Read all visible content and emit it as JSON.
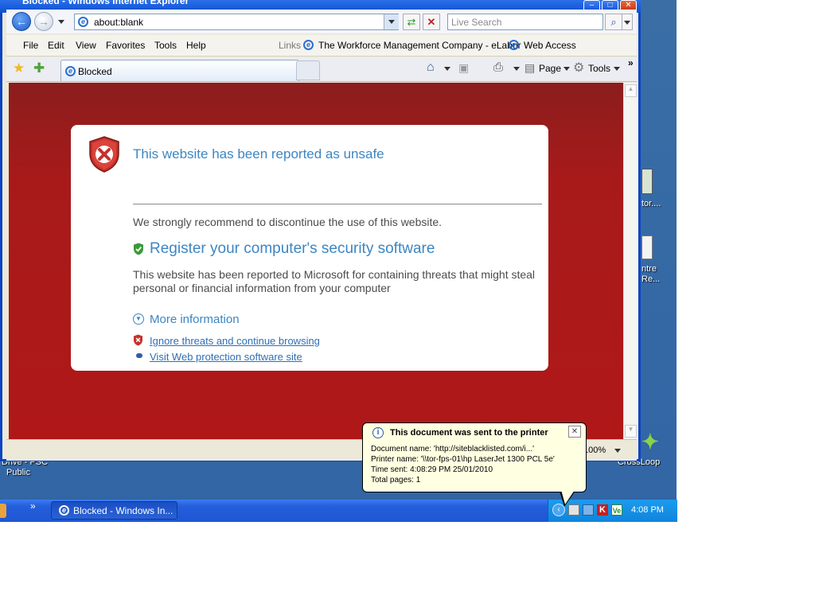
{
  "window": {
    "title": "Blocked - Windows Internet Explorer"
  },
  "address_bar": {
    "url": "about:blank"
  },
  "search": {
    "placeholder": "Live Search"
  },
  "menu": [
    "File",
    "Edit",
    "View",
    "Favorites",
    "Tools",
    "Help"
  ],
  "links": {
    "label": "Links",
    "items": [
      "The Workforce Management Company - eLabor",
      "Web Access"
    ]
  },
  "tab": {
    "title": "Blocked"
  },
  "command_bar": {
    "page_label": "Page",
    "tools_label": "Tools"
  },
  "warning_page": {
    "title": "This website has been reported as unsafe",
    "recommendation": "We strongly recommend to discontinue the use of this website.",
    "register_heading": "Register your computer's security software",
    "description": "This website has been reported to Microsoft for containing threats that might steal personal or financial information from your computer",
    "more_info": "More information",
    "ignore_link": "Ignore threats and continue browsing",
    "visit_link": "Visit Web protection software site"
  },
  "status_bar": {
    "zoom": "100%"
  },
  "balloon": {
    "title": "This document was sent to the printer",
    "doc_name": "Document name: 'http://siteblacklisted.com/i...'",
    "printer": "Printer name: '\\\\tor-fps-01\\hp LaserJet 1300 PCL 5e'",
    "time_sent": "Time sent: 4:08:29 PM  25/01/2010",
    "pages": "Total pages: 1"
  },
  "taskbar": {
    "task_label": "Blocked - Windows In...",
    "clock": "4:08 PM"
  },
  "desktop_icons": {
    "left_label_1": "Drive - PSC",
    "left_label_2": "Public",
    "right_label_1": "tor....",
    "right_label_2": "ntre",
    "right_label_3": "Re...",
    "right_label_4": "CrossLoop"
  }
}
